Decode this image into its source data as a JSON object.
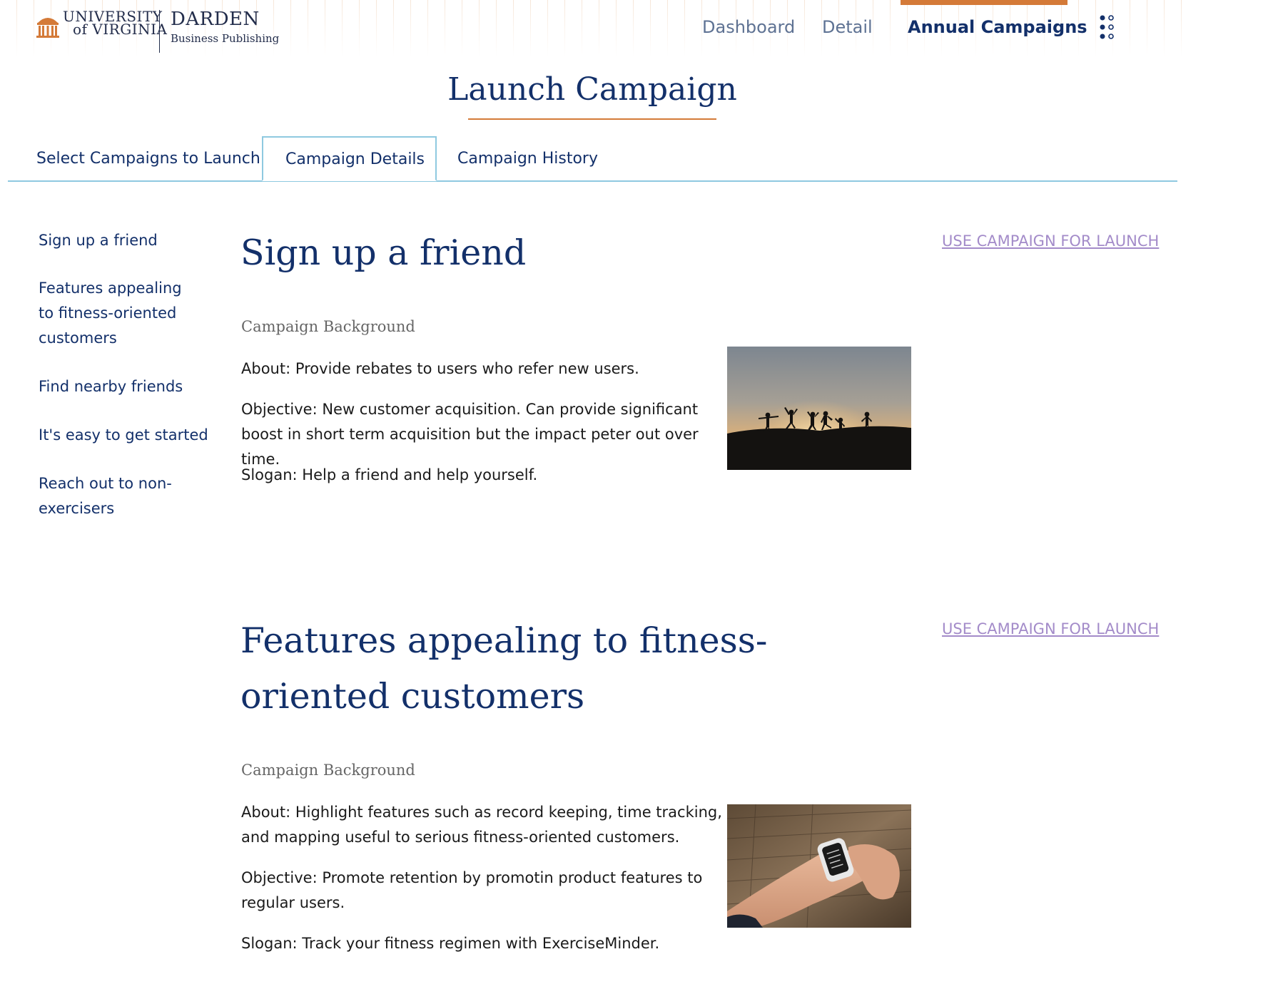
{
  "header": {
    "logo": {
      "university_line1": "UNIVERSITY",
      "university_line2": "of VIRGINIA",
      "darden": "DARDEN",
      "darden_sub": "Business Publishing"
    },
    "nav": {
      "items": [
        {
          "label": "Dashboard",
          "active": false
        },
        {
          "label": "Detail",
          "active": false
        },
        {
          "label": "Annual Campaigns",
          "active": true
        }
      ],
      "apps_icon": "apps-grid-icon"
    }
  },
  "page": {
    "title": "Launch Campaign"
  },
  "tabs": [
    {
      "label": "Select Campaigns to Launch",
      "active": false
    },
    {
      "label": "Campaign Details",
      "active": true
    },
    {
      "label": "Campaign History",
      "active": false
    }
  ],
  "sidebar": {
    "items": [
      {
        "label": "Sign up a friend"
      },
      {
        "label": "Features appealing to fitness-oriented customers"
      },
      {
        "label": "Find nearby friends"
      },
      {
        "label": "It's easy to get started"
      },
      {
        "label": "Reach out to non-exercisers"
      }
    ]
  },
  "campaigns": [
    {
      "title": "Sign up a friend",
      "use_label": "USE CAMPAIGN FOR LAUNCH",
      "background_label": "Campaign Background",
      "about": "About: Provide rebates to users who refer new users.",
      "objective": "Objective: New customer acquisition. Can provide significant boost in short term acquisition but the impact peter out over time.",
      "slogan": "Slogan: Help a friend and help yourself.",
      "image": "people-jumping-sunset-photo"
    },
    {
      "title": "Features appealing to fitness-oriented customers",
      "use_label": "USE CAMPAIGN FOR LAUNCH",
      "background_label": "Campaign Background",
      "about": "About: Highlight features such as record keeping, time tracking, and mapping useful to serious fitness-oriented customers.",
      "objective": "Objective: Promote retention by promotin product features to regular users.",
      "slogan": "Slogan: Track your fitness regimen with ExerciseMinder.",
      "image": "smartwatch-wrist-photo"
    }
  ],
  "colors": {
    "navy": "#13306a",
    "accent_orange": "#d47a38",
    "tab_border": "#8fc9e0",
    "link_purple": "#a38bc9",
    "nav_inactive": "#5e7293"
  }
}
